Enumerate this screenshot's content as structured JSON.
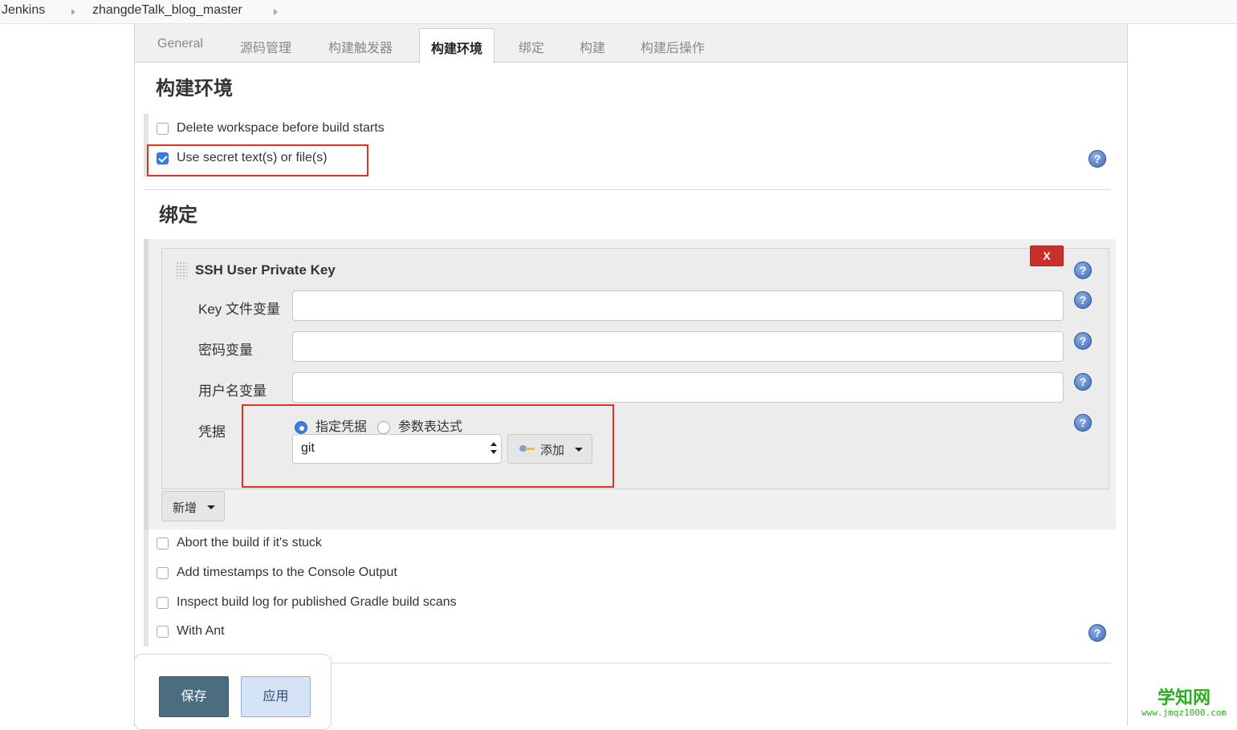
{
  "breadcrumb": {
    "root": "Jenkins",
    "job": "zhangdeTalk_blog_master"
  },
  "tabs": [
    {
      "label": "General"
    },
    {
      "label": "源码管理"
    },
    {
      "label": "构建触发器"
    },
    {
      "label": "构建环境",
      "active": true
    },
    {
      "label": "绑定"
    },
    {
      "label": "构建"
    },
    {
      "label": "构建后操作"
    }
  ],
  "build_env": {
    "title": "构建环境",
    "options": [
      {
        "label": "Delete workspace before build starts",
        "checked": false
      },
      {
        "label": "Use secret text(s) or file(s)",
        "checked": true
      }
    ]
  },
  "binding": {
    "title": "绑定",
    "block_title": "SSH User Private Key",
    "remove_label": "X",
    "fields": {
      "key_var": {
        "label": "Key 文件变量",
        "value": ""
      },
      "password_var": {
        "label": "密码变量",
        "value": ""
      },
      "username_var": {
        "label": "用户名变量",
        "value": ""
      }
    },
    "credentials": {
      "label": "凭据",
      "radio_specific": "指定凭据",
      "radio_param": "参数表达式",
      "selected": "git",
      "add_label": "添加"
    },
    "add_new_label": "新增"
  },
  "more_options": [
    {
      "label": "Abort the build if it's stuck",
      "checked": false
    },
    {
      "label": "Add timestamps to the Console Output",
      "checked": false
    },
    {
      "label": "Inspect build log for published Gradle build scans",
      "checked": false
    },
    {
      "label": "With Ant",
      "checked": false
    }
  ],
  "actions": {
    "save": "保存",
    "apply": "应用"
  },
  "help_icon_glyph": "?",
  "watermark": {
    "main": "学知网",
    "sub": "www.jmqz1000.com"
  },
  "colors": {
    "highlight_box": "#e0341e",
    "save_button": "#4c6c80",
    "checkbox_checked": "#3a7de0"
  }
}
